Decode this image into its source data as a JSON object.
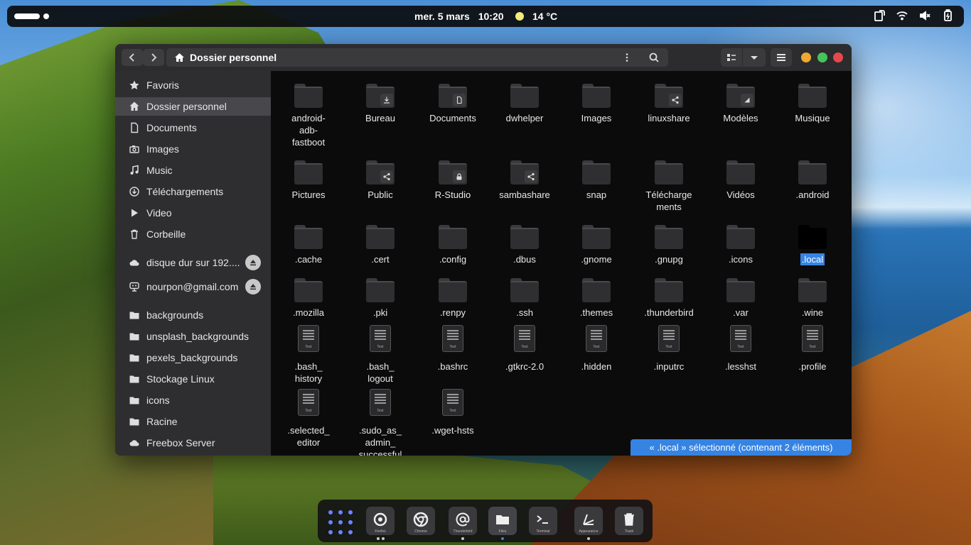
{
  "topbar": {
    "date": "mer. 5 mars",
    "time": "10:20",
    "temperature": "14 °C",
    "tray_icons": [
      "screen-rotate-icon",
      "wifi-icon",
      "volume-muted-icon",
      "battery-icon"
    ]
  },
  "window": {
    "title": "Dossier personnel",
    "controls": {
      "close": "#e5484d",
      "maximize": "#46c35a",
      "minimize": "#f0a832"
    }
  },
  "sidebar": {
    "items": [
      {
        "label": "Favoris",
        "icon": "star-icon"
      },
      {
        "label": "Dossier personnel",
        "icon": "home-icon",
        "active": true
      },
      {
        "label": "Documents",
        "icon": "document-icon"
      },
      {
        "label": "Images",
        "icon": "camera-icon"
      },
      {
        "label": "Music",
        "icon": "music-icon"
      },
      {
        "label": "Téléchargements",
        "icon": "download-icon"
      },
      {
        "label": "Video",
        "icon": "play-icon"
      },
      {
        "label": "Corbeille",
        "icon": "trash-icon"
      },
      {
        "label": "disque dur sur 192....",
        "icon": "cloud-icon",
        "eject": true
      },
      {
        "label": "nourpon@gmail.com",
        "icon": "online-account-icon",
        "eject": true
      },
      {
        "label": "backgrounds",
        "icon": "folder-icon"
      },
      {
        "label": "unsplash_backgrounds",
        "icon": "folder-icon"
      },
      {
        "label": "pexels_backgrounds",
        "icon": "folder-icon"
      },
      {
        "label": "Stockage Linux",
        "icon": "folder-icon"
      },
      {
        "label": "icons",
        "icon": "folder-icon"
      },
      {
        "label": "Racine",
        "icon": "folder-icon"
      },
      {
        "label": "Freebox Server",
        "icon": "cloud-icon"
      }
    ]
  },
  "files": [
    {
      "name": "android-\nadb-\nfastboot",
      "type": "folder"
    },
    {
      "name": "Bureau",
      "type": "folder",
      "badge": "desktop"
    },
    {
      "name": "Documents",
      "type": "folder",
      "badge": "documents"
    },
    {
      "name": "dwhelper",
      "type": "folder"
    },
    {
      "name": "Images",
      "type": "folder"
    },
    {
      "name": "linuxshare",
      "type": "folder",
      "badge": "share"
    },
    {
      "name": "Modèles",
      "type": "folder",
      "badge": "templates"
    },
    {
      "name": "Musique",
      "type": "folder"
    },
    {
      "name": "Pictures",
      "type": "folder"
    },
    {
      "name": "Public",
      "type": "folder",
      "badge": "share"
    },
    {
      "name": "R-Studio",
      "type": "folder",
      "badge": "lock"
    },
    {
      "name": "sambashare",
      "type": "folder",
      "badge": "share"
    },
    {
      "name": "snap",
      "type": "folder"
    },
    {
      "name": "Télécharge\nments",
      "type": "folder"
    },
    {
      "name": "Vidéos",
      "type": "folder"
    },
    {
      "name": ".android",
      "type": "folder"
    },
    {
      "name": ".cache",
      "type": "folder"
    },
    {
      "name": ".cert",
      "type": "folder"
    },
    {
      "name": ".config",
      "type": "folder"
    },
    {
      "name": ".dbus",
      "type": "folder"
    },
    {
      "name": ".gnome",
      "type": "folder"
    },
    {
      "name": ".gnupg",
      "type": "folder"
    },
    {
      "name": ".icons",
      "type": "folder"
    },
    {
      "name": ".local",
      "type": "folder",
      "selected": true
    },
    {
      "name": ".mozilla",
      "type": "folder"
    },
    {
      "name": ".pki",
      "type": "folder"
    },
    {
      "name": ".renpy",
      "type": "folder"
    },
    {
      "name": ".ssh",
      "type": "folder"
    },
    {
      "name": ".themes",
      "type": "folder"
    },
    {
      "name": ".thunderbird",
      "type": "folder"
    },
    {
      "name": ".var",
      "type": "folder"
    },
    {
      "name": ".wine",
      "type": "folder"
    },
    {
      "name": ".bash_\nhistory",
      "type": "text"
    },
    {
      "name": ".bash_\nlogout",
      "type": "text"
    },
    {
      "name": ".bashrc",
      "type": "text"
    },
    {
      "name": ".gtkrc-2.0",
      "type": "text"
    },
    {
      "name": ".hidden",
      "type": "text"
    },
    {
      "name": ".inputrc",
      "type": "text"
    },
    {
      "name": ".lesshst",
      "type": "text"
    },
    {
      "name": ".profile",
      "type": "text"
    },
    {
      "name": ".selected_\neditor",
      "type": "text"
    },
    {
      "name": ".sudo_as_\nadmin_\nsuccessful",
      "type": "text"
    },
    {
      "name": ".wget-hsts",
      "type": "text"
    }
  ],
  "text_file_label": "Text",
  "status": "« .local » sélectionné  (contenant 2 éléments)",
  "dock": [
    {
      "label": "Firefox",
      "icon": "firefox-icon",
      "dots": 2
    },
    {
      "label": "Chrome",
      "icon": "chrome-icon",
      "dots": 0
    },
    {
      "label": "Thunderbird",
      "icon": "at-mail-icon",
      "dots": 1
    },
    {
      "label": "Files",
      "icon": "files-icon",
      "dots": 1,
      "active": true
    },
    {
      "label": "Terminal",
      "icon": "terminal-icon",
      "dots": 0
    },
    {
      "label": "Appearance",
      "icon": "appearance-icon",
      "dots": 1
    },
    {
      "label": "Trash",
      "icon": "trash-icon",
      "dots": 0
    }
  ],
  "colors": {
    "accent": "#3584e4",
    "dock_apps": "#6e83ff"
  }
}
